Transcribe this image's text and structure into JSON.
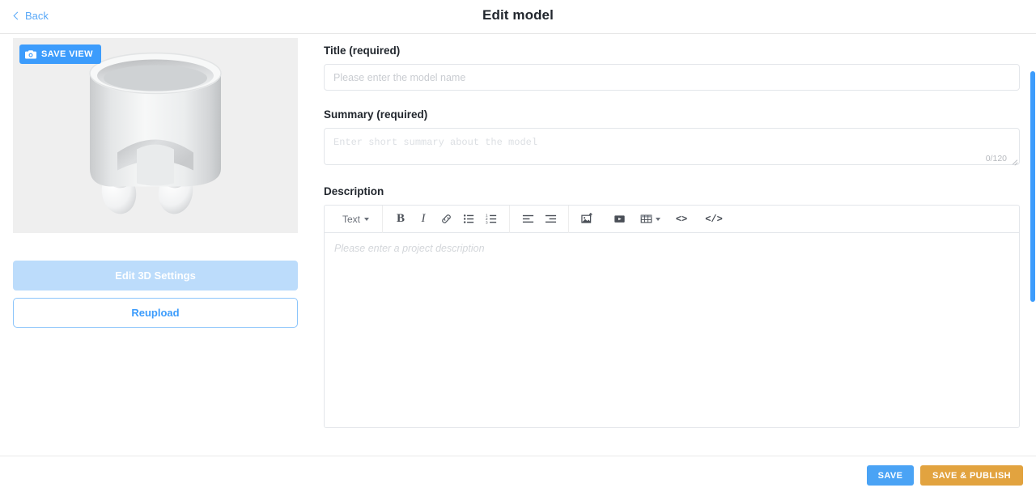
{
  "header": {
    "back_label": "Back",
    "back_icon": "chevron-left-icon",
    "title": "Edit model"
  },
  "viewer": {
    "save_view_label": "SAVE VIEW",
    "save_view_icon": "camera-icon",
    "background_color": "#efefef",
    "model_description": "white 3d planter pot with two legs"
  },
  "left_actions": {
    "edit_3d_label": "Edit 3D Settings",
    "reupload_label": "Reupload"
  },
  "form": {
    "title_label": "Title (required)",
    "title_value": "",
    "title_placeholder": "Please enter the model name",
    "summary_label": "Summary (required)",
    "summary_value": "",
    "summary_placeholder": "Enter short summary about the model",
    "summary_counter": "0/120",
    "description_label": "Description",
    "description_placeholder": "Please enter a project description"
  },
  "editor_toolbar": {
    "style_label": "Text",
    "style_caret_icon": "chevron-down-icon",
    "bold_label": "B",
    "italic_label": "I",
    "link_icon": "link-icon",
    "bullet_list_icon": "bullet-list-icon",
    "ordered_list_icon": "ordered-list-icon",
    "align_left_icon": "align-left-icon",
    "align_right_icon": "align-right-icon",
    "image_icon": "image-upload-icon",
    "video_icon": "video-icon",
    "table_icon": "table-icon",
    "table_caret_icon": "chevron-down-icon",
    "inline_code_label": "<>",
    "code_block_label": "</>"
  },
  "footer": {
    "save_label": "SAVE",
    "publish_label": "SAVE & PUBLISH"
  },
  "colors": {
    "accent_blue": "#3c9cfc",
    "save_blue": "#4aa3f5",
    "publish_orange": "#e2a33f",
    "disabled_blue": "#bcdcfb",
    "viewer_bg": "#efefef"
  },
  "scrollbar": {
    "orientation": "vertical",
    "color": "#3c9cfc"
  }
}
